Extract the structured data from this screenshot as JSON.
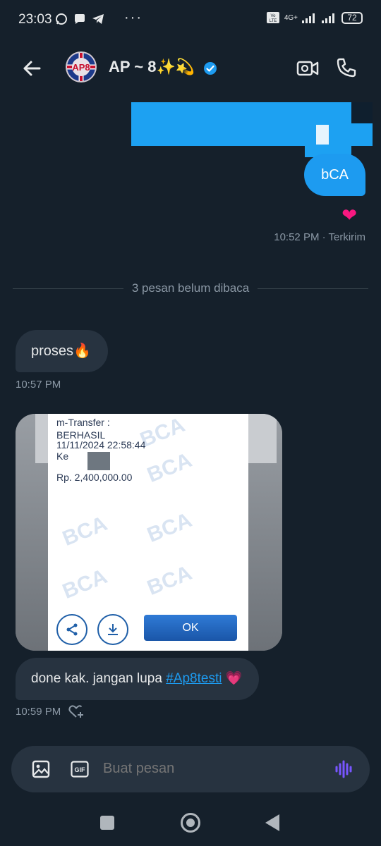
{
  "status_bar": {
    "time": "23:03",
    "network": "4G+",
    "volte": "Vo LTE",
    "battery": "72",
    "more_dots": "···"
  },
  "header": {
    "avatar_label": "AP8",
    "title": "AP ~ 8✨💫",
    "verified": true
  },
  "messages": {
    "outgoing_1": "bCA",
    "outgoing_reaction": "❤",
    "outgoing_meta": "10:52 PM · Terkirim",
    "unread_divider": "3 pesan belum dibaca",
    "incoming_1": "proses🔥",
    "incoming_1_time": "10:57 PM",
    "receipt": {
      "line1": "m-Transfer :",
      "line2": "BERHASIL",
      "line3": "11/11/2024 22:58:44",
      "line4": "Ke",
      "amount": "Rp. 2,400,000.00",
      "ok_label": "OK",
      "watermark": "BCA"
    },
    "incoming_2_text": "done kak. jangan lupa ",
    "incoming_2_tag": "#Ap8testi",
    "incoming_2_emoji": "💗",
    "incoming_2_time": "10:59 PM"
  },
  "composer": {
    "placeholder": "Buat pesan",
    "gif_label": "GIF"
  },
  "colors": {
    "background": "#15202b",
    "accent": "#1d9bf0",
    "bubble_in": "#273340"
  }
}
